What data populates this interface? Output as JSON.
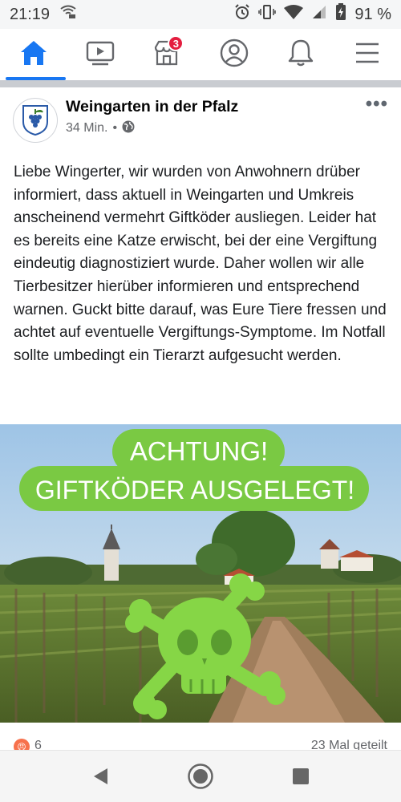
{
  "status_bar": {
    "time": "21:19",
    "battery_percent": "91 %",
    "icons": [
      "wifi-call-icon",
      "alarm-icon",
      "vibrate-icon",
      "wifi-icon",
      "signal-icon",
      "battery-icon"
    ]
  },
  "nav": {
    "items": [
      {
        "name": "home",
        "icon": "home-icon",
        "active": true
      },
      {
        "name": "watch",
        "icon": "video-icon",
        "active": false
      },
      {
        "name": "marketplace",
        "icon": "marketplace-icon",
        "active": false,
        "badge": "3"
      },
      {
        "name": "profile",
        "icon": "profile-icon",
        "active": false
      },
      {
        "name": "notifications",
        "icon": "bell-icon",
        "active": false
      },
      {
        "name": "menu",
        "icon": "menu-icon",
        "active": false
      }
    ],
    "accent_color": "#1877f2",
    "badge_color": "#e41e3f"
  },
  "post": {
    "page_name": "Weingarten in der Pfalz",
    "time": "34 Min.",
    "separator": "•",
    "audience_icon": "globe-icon",
    "text": "Liebe Wingerter, wir wurden von Anwohnern drüber informiert, dass aktuell in Weingarten und Umkreis anscheinend vermehrt Giftköder ausliegen. Leider hat es bereits eine Katze erwischt, bei der eine Vergiftung eindeutig diagnostiziert wurde. Daher wollen wir alle Tierbesitzer hierüber informieren und entsprechend warnen. Guckt bitte darauf, was Eure Tiere fressen und achtet auf eventuelle Vergiftungs-Symptome. Im Notfall sollte umbedingt ein Tierarzt aufgesucht werden.",
    "image": {
      "line1": "ACHTUNG!",
      "line2": "GIFTKÖDER AUSGELEGT!",
      "banner_color": "#7ac943"
    },
    "reaction_count": "6",
    "shares": "23 Mal geteilt"
  }
}
